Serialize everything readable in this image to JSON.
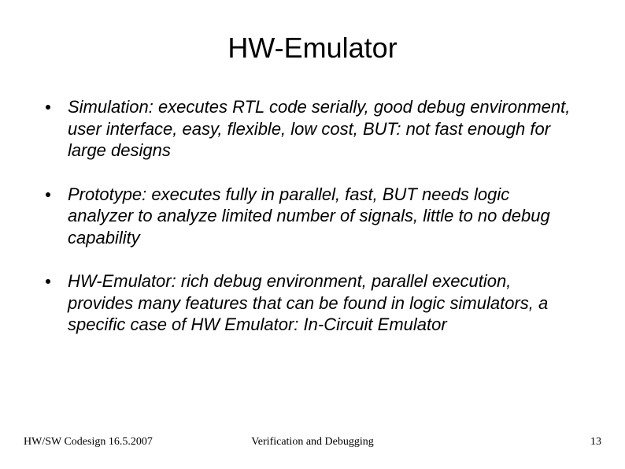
{
  "title": "HW-Emulator",
  "bullets": [
    "Simulation: executes RTL code serially, good debug environment, user interface, easy, flexible, low cost, BUT: not fast enough for large designs",
    "Prototype: executes fully in parallel, fast, BUT needs logic analyzer to analyze limited number of signals, little to no debug capability",
    "HW-Emulator: rich debug environment, parallel execution, provides many features that can be found in logic simulators, a specific case of HW Emulator: In-Circuit Emulator"
  ],
  "footer": {
    "left": "HW/SW Codesign 16.5.2007",
    "center": "Verification and Debugging",
    "right": "13"
  }
}
